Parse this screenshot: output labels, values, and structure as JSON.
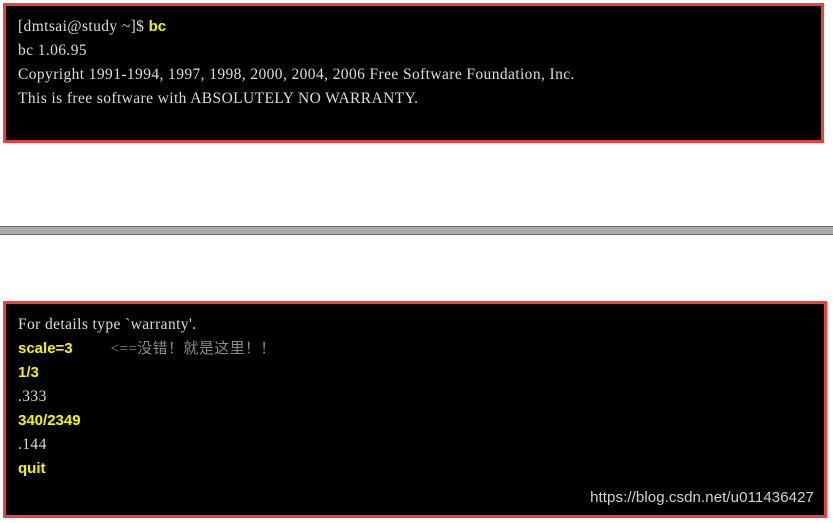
{
  "terminal_top": {
    "lines": [
      {
        "prefix": "[dmtsai@study ~]$ ",
        "command": "bc"
      },
      {
        "prefix": "bc 1.06.95",
        "command": ""
      },
      {
        "prefix": "Copyright 1991-1994, 1997, 1998, 2000, 2004, 2006 Free Software Foundation, Inc.",
        "command": ""
      },
      {
        "prefix": "This is free software with ABSOLUTELY NO WARRANTY.",
        "command": ""
      }
    ]
  },
  "terminal_bottom": {
    "lines": [
      {
        "text": "For details type `warranty'.",
        "style": "plain",
        "annotation": ""
      },
      {
        "text": "scale=3",
        "style": "input",
        "annotation": "<==没错！就是这里！！"
      },
      {
        "text": "1/3",
        "style": "input",
        "annotation": ""
      },
      {
        "text": ".333",
        "style": "plain",
        "annotation": ""
      },
      {
        "text": "340/2349",
        "style": "input",
        "annotation": ""
      },
      {
        "text": ".144",
        "style": "plain",
        "annotation": ""
      },
      {
        "text": "quit",
        "style": "input",
        "annotation": ""
      }
    ]
  },
  "watermark": {
    "text": "https://blog.csdn.net/u011436427"
  },
  "colors": {
    "highlight_border": "#fb3b3b",
    "terminal_background": "#000000",
    "terminal_text": "#dcdcdc",
    "command_text": "#f5f500",
    "annotation_text": "#8a8a8a",
    "divider": "#a9a9a9",
    "watermark_text": "#d2d2d2"
  }
}
